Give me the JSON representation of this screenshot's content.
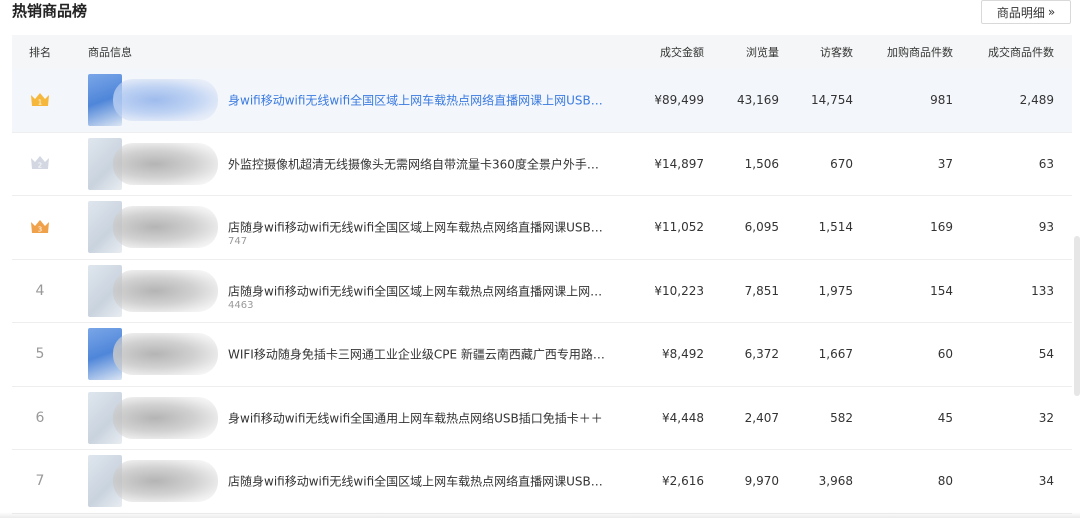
{
  "page": {
    "title": "热销商品榜",
    "detail_button": {
      "label": "商品明细",
      "icon": "double-chevron-right-icon",
      "glyph": "»"
    }
  },
  "table": {
    "columns": {
      "rank": "排名",
      "info": "商品信息",
      "amount": "成交金额",
      "views": "浏览量",
      "visitors": "访客数",
      "cart": "加购商品件数",
      "deal": "成交商品件数"
    },
    "rows": [
      {
        "rank": "1",
        "rank_icon": "gold-crown-icon",
        "name": "身wifi移动wifi无线wifi全国区域上网车载热点网络直播网课上网USB插口免插卡＋",
        "id": "",
        "amount": "¥89,499",
        "views": "43,169",
        "visitors": "14,754",
        "cart": "981",
        "deal": "2,489",
        "highlight": true
      },
      {
        "rank": "2",
        "rank_icon": "silver-crown-icon",
        "name": "外监控摄像机超清无线摄像头无需网络自带流量卡360度全景户外手机远程",
        "id": "",
        "amount": "¥14,897",
        "views": "1,506",
        "visitors": "670",
        "cart": "37",
        "deal": "63",
        "highlight": false
      },
      {
        "rank": "3",
        "rank_icon": "bronze-crown-icon",
        "name": "店随身wifi移动wifi无线wifi全国区域上网车载热点网络直播网课USB插口免插卡",
        "id": "747",
        "amount": "¥11,052",
        "views": "6,095",
        "visitors": "1,514",
        "cart": "169",
        "deal": "93",
        "highlight": false
      },
      {
        "rank": "4",
        "rank_icon": "",
        "name": "店随身wifi移动wifi无线wifi全国区域上网车载热点网络直播网课上网USB插口免插卡",
        "id": "4463",
        "amount": "¥10,223",
        "views": "7,851",
        "visitors": "1,975",
        "cart": "154",
        "deal": "133",
        "highlight": false
      },
      {
        "rank": "5",
        "rank_icon": "",
        "name": "WIFI移动随身免插卡三网通工业企业级CPE 新疆云南西藏广西专用路由器",
        "id": "",
        "amount": "¥8,492",
        "views": "6,372",
        "visitors": "1,667",
        "cart": "60",
        "deal": "54",
        "highlight": false
      },
      {
        "rank": "6",
        "rank_icon": "",
        "name": "身wifi移动wifi无线wifi全国通用上网车载热点网络USB插口免插卡＋＋",
        "id": "",
        "amount": "¥4,448",
        "views": "2,407",
        "visitors": "582",
        "cart": "45",
        "deal": "32",
        "highlight": false
      },
      {
        "rank": "7",
        "rank_icon": "",
        "name": "店随身wifi移动wifi无线wifi全国区域上网车载热点网络直播网课USB插口免插卡",
        "id": "",
        "amount": "¥2,616",
        "views": "9,970",
        "visitors": "3,968",
        "cart": "80",
        "deal": "34",
        "highlight": false
      }
    ]
  },
  "colors": {
    "link": "#3b7be0",
    "header_bg": "#f5f6f7",
    "highlight_row": "#f3f6fb",
    "gold": "#f5b83d",
    "silver": "#d3d7e2",
    "bronze": "#f0a24a"
  }
}
